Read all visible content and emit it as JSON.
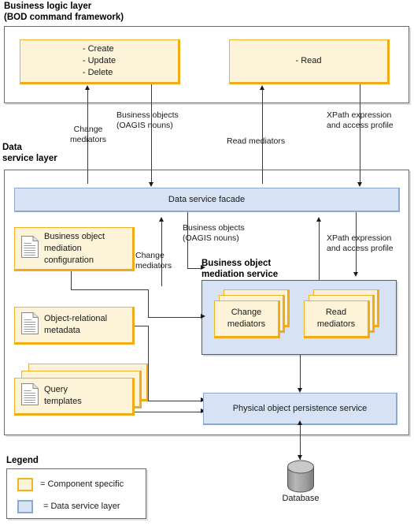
{
  "diagram": {
    "title_business_layer": "Business logic layer\n(BOD command framework)",
    "title_data_layer": "Data\nservice layer"
  },
  "business_layer": {
    "write_operations_box": "- Create\n- Update\n- Delete",
    "read_operations_box": "- Read"
  },
  "connector_labels": {
    "change_mediators_top": "Change\nmediators",
    "business_objects_top": "Business objects\n(OAGIS nouns)",
    "read_mediators_top": "Read mediators",
    "xpath_top": "XPath expression\nand access profile",
    "change_mediators_mid": "Change\nmediators",
    "business_objects_mid": "Business objects\n(OAGIS nouns)",
    "xpath_mid": "XPath expression\nand access profile"
  },
  "data_layer": {
    "facade": "Data service facade",
    "mediation_service_title": "Business object\nmediation service",
    "change_mediators_card": "Change\nmediators",
    "read_mediators_card": "Read\nmediators",
    "persistence_service": "Physical object persistence service",
    "artifacts": [
      {
        "label": "Business object\nmediation\nconfiguration",
        "icon": "document-icon"
      },
      {
        "label": "Object-relational\nmetadata",
        "icon": "document-icon"
      },
      {
        "label": "Query\ntemplates",
        "icon": "document-icon"
      }
    ]
  },
  "database": {
    "label": "Database",
    "icon": "database-cylinder-icon"
  },
  "legend": {
    "title": "Legend",
    "items": [
      {
        "swatch": "component-specific",
        "text": "= Component specific"
      },
      {
        "swatch": "data-service-layer",
        "text": "= Data service layer"
      }
    ]
  },
  "colors": {
    "component_specific_fill": "#fdf3d8",
    "component_specific_border": "#f0b323",
    "data_service_fill": "#d7e3f4",
    "data_service_border": "#8ba9d0",
    "line": "#3a3a3a",
    "frame": "#6b6b6b",
    "database_fill": "#9e9e9e"
  }
}
